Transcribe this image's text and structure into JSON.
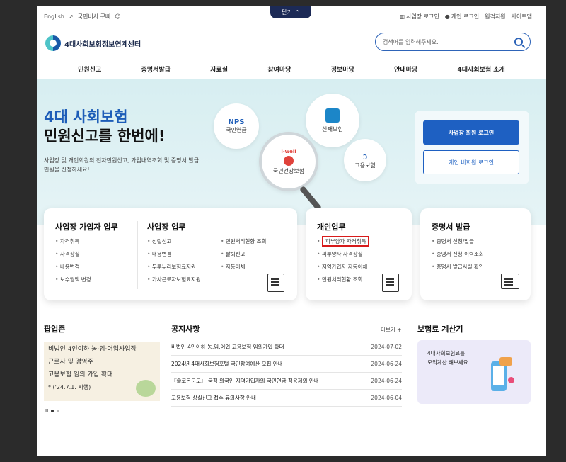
{
  "topbar": {
    "lang": "English",
    "cert": "국민비서 구삐",
    "close": "닫기",
    "biz_login": "사업장 로그인",
    "personal_login": "개인 로그인",
    "remote": "원격지원",
    "sitemap": "사이트맵"
  },
  "header": {
    "logo": "4대사회보험정보연계센터",
    "search_placeholder": "검색어를 입력해주세요."
  },
  "nav": [
    "민원신고",
    "증명서발급",
    "자료실",
    "참여마당",
    "정보마당",
    "안내마당",
    "4대사회보험 소개"
  ],
  "hero": {
    "title_line1": "4대 사회보험",
    "title_line2": "민원신고를 한번에!",
    "desc": "사업장 및 개인회원의 전자민원신고, 가입내역조회 및 증명서 발급 민원을 신청하세요!",
    "circles": {
      "nps_logo": "NPS",
      "nps": "국민연금",
      "comwel": "산재보험",
      "nhis_logo": "i-well",
      "nhis": "국민건강보험",
      "ei": "고용보험"
    },
    "biz_login_btn": "사업장 회원 로그인",
    "nonmember_btn": "개인 비회원 로그인"
  },
  "cards": {
    "subscriber": {
      "title": "사업장 가입자 업무",
      "items": [
        "자격취득",
        "자격상실",
        "내용변경",
        "보수월액 변경"
      ]
    },
    "workplace": {
      "title": "사업장 업무",
      "items_left": [
        "성립신고",
        "내용변경",
        "두루누리보험료지원",
        "가사근로자보험료지원"
      ],
      "items_right": [
        "민원처리현황 조회",
        "탈퇴신고",
        "자동이체"
      ]
    },
    "personal": {
      "title": "개인업무",
      "items": [
        "피부양자 자격취득",
        "피부양자 자격상실",
        "지역가입자 자동이체",
        "민원처리현황 조회"
      ]
    },
    "certificate": {
      "title": "증명서 발급",
      "items": [
        "증명서 신청/발급",
        "증명서 신청 이력조회",
        "증명서 발급사실 확인"
      ]
    }
  },
  "popup": {
    "title": "팝업존",
    "line1": "비법인 4인이하 농·임·어업사업장",
    "line2": "근로자 및 경영주",
    "line3": "고용보험 임의 가입 확대",
    "line4": "* ('24.7.1. 시행)"
  },
  "notice": {
    "title": "공지사항",
    "more": "더보기 +",
    "items": [
      {
        "title": "비법인 4인이하 농,임,어업 고용보험 임의가입 확대",
        "date": "2024-07-02"
      },
      {
        "title": "2024년 4대사회보험포털 국민참여예산 모집 안내",
        "date": "2024-06-24"
      },
      {
        "title": "『슬로몬군도』 국적 외국인 지역가입자의 국민연금 적용제외 안내",
        "date": "2024-06-24"
      },
      {
        "title": "고용보험 상실신고 접수 유의사항 안내",
        "date": "2024-06-04"
      }
    ]
  },
  "calculator": {
    "title": "보험료 계산기",
    "desc_line1": "4대사회보험료를",
    "desc_line2": "모의계산 해보세요."
  }
}
